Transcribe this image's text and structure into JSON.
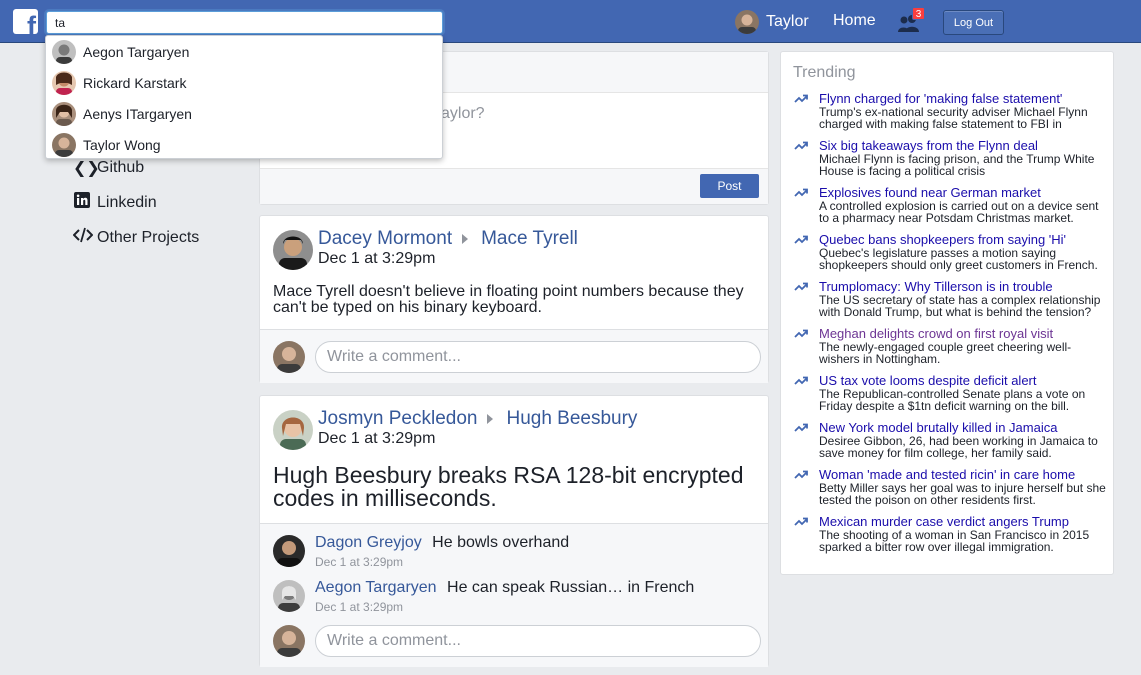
{
  "header": {
    "search_value": "ta",
    "user_name": "Taylor",
    "home_label": "Home",
    "friend_requests_count": "3",
    "logout_label": "Log Out"
  },
  "search_results": [
    {
      "name": "Aegon Targaryen"
    },
    {
      "name": "Rickard Karstark"
    },
    {
      "name": "Aenys ITargaryen"
    },
    {
      "name": "Taylor Wong"
    }
  ],
  "sidebar": {
    "links": [
      {
        "label": "Github",
        "icon": "github-icon"
      },
      {
        "label": "Linkedin",
        "icon": "linkedin-icon"
      },
      {
        "label": "Other Projects",
        "icon": "code-icon"
      }
    ]
  },
  "composer": {
    "prompt_fragment": "aylor?",
    "post_label": "Post"
  },
  "posts": [
    {
      "author": "Dacey Mormont",
      "target": "Mace Tyrell",
      "time": "Dec 1 at 3:29pm",
      "body": "Mace Tyrell doesn't believe in floating point numbers because they can't be typed on his binary keyboard.",
      "comments": [],
      "comment_placeholder": "Write a comment..."
    },
    {
      "author": "Josmyn Peckledon",
      "target": "Hugh Beesbury",
      "time": "Dec 1 at 3:29pm",
      "body": "Hugh Beesbury breaks RSA 128-bit encrypted codes in milliseconds.",
      "comments": [
        {
          "author": "Dagon Greyjoy",
          "text": "He bowls overhand",
          "time": "Dec 1 at 3:29pm"
        },
        {
          "author": "Aegon Targaryen",
          "text": "He can speak Russian… in French",
          "time": "Dec 1 at 3:29pm"
        }
      ],
      "comment_placeholder": "Write a comment..."
    }
  ],
  "trending": {
    "title": "Trending",
    "items": [
      {
        "title": "Flynn charged for 'making false statement'",
        "desc": "Trump's ex-national security adviser Michael Flynn charged with making false statement to FBI in"
      },
      {
        "title": "Six big takeaways from the Flynn deal",
        "desc": "Michael Flynn is facing prison, and the Trump White House is facing a political crisis"
      },
      {
        "title": "Explosives found near German market",
        "desc": "A controlled explosion is carried out on a device sent to a pharmacy near Potsdam Christmas market."
      },
      {
        "title": "Quebec bans shopkeepers from saying 'Hi'",
        "desc": "Quebec's legislature passes a motion saying shopkeepers should only greet customers in French."
      },
      {
        "title": "Trumplomacy: Why Tillerson is in trouble",
        "desc": "The US secretary of state has a complex relationship with Donald Trump, but what is behind the tension?"
      },
      {
        "title": "Meghan delights crowd on first royal visit",
        "desc": "The newly-engaged couple greet cheering well-wishers in Nottingham."
      },
      {
        "title": "US tax vote looms despite deficit alert",
        "desc": "The Republican-controlled Senate plans a vote on Friday despite a $1tn deficit warning on the bill."
      },
      {
        "title": "New York model brutally killed in Jamaica",
        "desc": "Desiree Gibbon, 26, had been working in Jamaica to save money for film college, her family said."
      },
      {
        "title": "Woman 'made and tested ricin' in care home",
        "desc": "Betty Miller says her goal was to injure herself but she tested the poison on other residents first."
      },
      {
        "title": "Mexican murder case verdict angers Trump",
        "desc": "The shooting of a woman in San Francisco in 2015 sparked a bitter row over illegal immigration."
      }
    ]
  },
  "colors": {
    "brand": "#4267b2",
    "link": "#365899",
    "trend_link": "#1a0dab",
    "trend_visited": "#6c3493",
    "badge": "#fa3e3e"
  }
}
